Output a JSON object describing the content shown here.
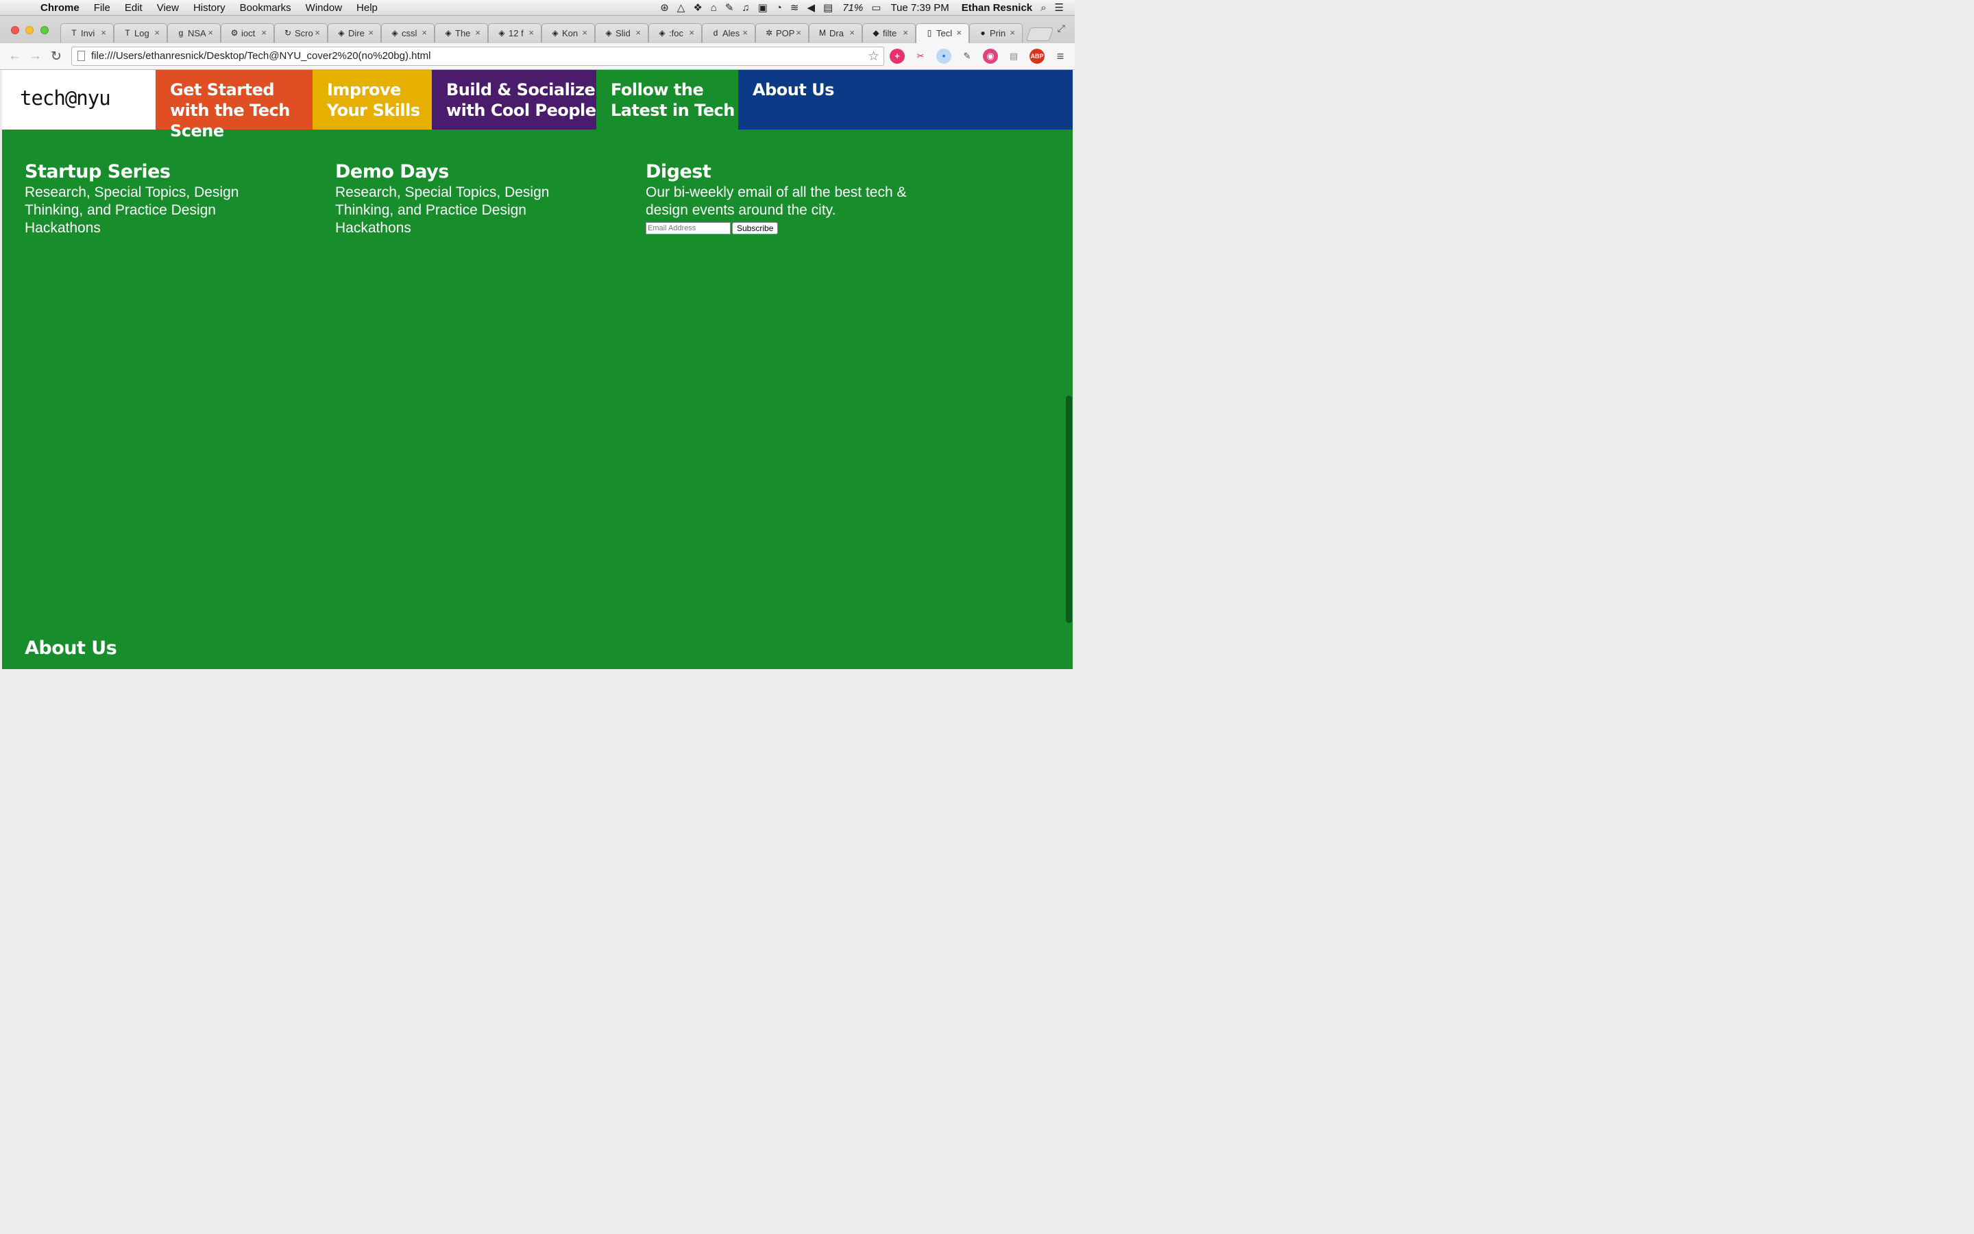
{
  "menubar": {
    "app_name": "Chrome",
    "menus": [
      "File",
      "Edit",
      "View",
      "History",
      "Bookmarks",
      "Window",
      "Help"
    ],
    "battery": "71%",
    "clock": "Tue 7:39 PM",
    "user": "Ethan Resnick"
  },
  "tabs": [
    {
      "label": "Invi",
      "icon": "T"
    },
    {
      "label": "Log",
      "icon": "T"
    },
    {
      "label": "NSA",
      "icon": "g"
    },
    {
      "label": "ioct",
      "icon": "⚙"
    },
    {
      "label": "Scro",
      "icon": "↻"
    },
    {
      "label": "Dire",
      "icon": "◈"
    },
    {
      "label": "cssl",
      "icon": "◈"
    },
    {
      "label": "The",
      "icon": "◈"
    },
    {
      "label": "12 f",
      "icon": "◈"
    },
    {
      "label": "Kon",
      "icon": "◈"
    },
    {
      "label": "Slid",
      "icon": "◈"
    },
    {
      "label": ":foc",
      "icon": "◈"
    },
    {
      "label": "Ales",
      "icon": "d"
    },
    {
      "label": "POP",
      "icon": "✲"
    },
    {
      "label": "Dra",
      "icon": "M"
    },
    {
      "label": "filte",
      "icon": "◆"
    },
    {
      "label": "Tecl",
      "icon": "▯",
      "active": true
    },
    {
      "label": "Prin",
      "icon": "●"
    }
  ],
  "omnibox": {
    "url": "file:///Users/ethanresnick/Desktop/Tech@NYU_cover2%20(no%20bg).html"
  },
  "site": {
    "logo": "tech@nyu",
    "nav": [
      {
        "label": "Get Started with the Tech Scene",
        "color": "#e04e23"
      },
      {
        "label": "Improve Your Skills",
        "color": "#e6b000"
      },
      {
        "label": "Build & Socialize with Cool People",
        "color": "#4a1c6b"
      },
      {
        "label": "Follow the Latest in Tech",
        "color": "#178d2c"
      },
      {
        "label": "About Us",
        "color": "#0c3a86"
      }
    ],
    "background": "#178d2c",
    "sections": {
      "startup": {
        "title": "Startup Series",
        "desc": "Research, Special Topics, Design Thinking, and Practice Design Hackathons"
      },
      "demo": {
        "title": "Demo Days",
        "desc": "Research, Special Topics, Design Thinking, and Practice Design Hackathons"
      },
      "digest": {
        "title": "Digest",
        "desc": "Our bi-weekly email of all the best tech & design events around the city."
      }
    },
    "subscribe": {
      "placeholder": "Email Address",
      "button": "Subscribe"
    },
    "about_heading": "About Us"
  }
}
